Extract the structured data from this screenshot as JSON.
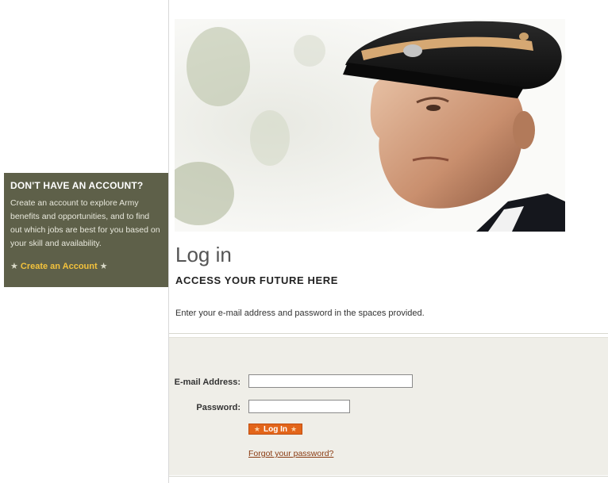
{
  "promo": {
    "title": "DON'T HAVE AN ACCOUNT?",
    "text": "Create an account to explore Army benefits and opportunities, and to find out which jobs are best for you based on your skill and availability.",
    "link_label": "Create an Account",
    "link_color": "#f3c23c",
    "background": "#5e6049"
  },
  "main": {
    "title": "Log in",
    "subtitle": "ACCESS YOUR FUTURE HERE",
    "instructions": "Enter your e-mail address and password in the spaces provided."
  },
  "form": {
    "email_label": "E-mail Address:",
    "email_value": "",
    "password_label": "Password:",
    "password_value": "",
    "login_label": "Log In",
    "forgot_label": "Forgot your password?",
    "button_color": "#e3651a"
  },
  "icons": {
    "star": "★"
  }
}
